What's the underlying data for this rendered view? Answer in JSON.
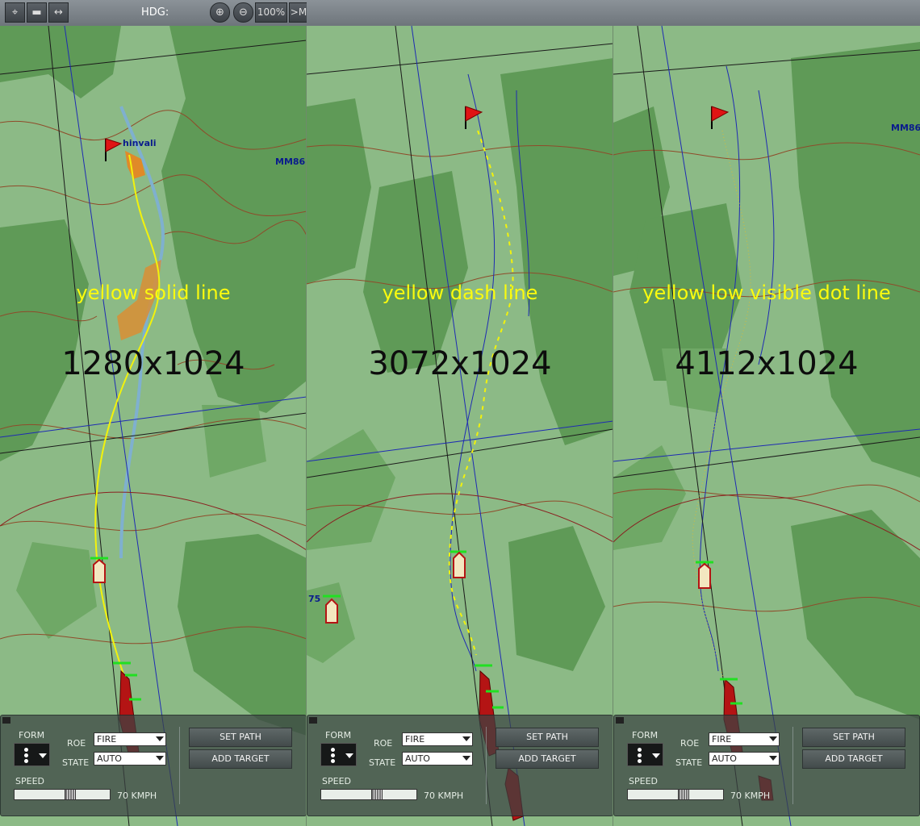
{
  "toolbar": {
    "hdg_label": "HDG:",
    "zoom_value": "100%",
    "more_label": ">M"
  },
  "map": {
    "town_label": "hinvali",
    "grid_label": "MM86",
    "unit_label": "75"
  },
  "panels": [
    {
      "caption": "yellow solid line",
      "resolution": "1280x1024"
    },
    {
      "caption": "yellow dash line",
      "resolution": "3072x1024"
    },
    {
      "caption": "yellow low visible dot line",
      "resolution": "4112x1024"
    }
  ],
  "control": {
    "form_label": "FORM",
    "roe_label": "ROE",
    "roe_value": "FIRE",
    "state_label": "STATE",
    "state_value": "AUTO",
    "speed_label": "SPEED",
    "speed_value": "70 KMPH",
    "set_path_label": "SET PATH",
    "add_target_label": "ADD TARGET"
  },
  "colors": {
    "forest": "#5f9a57",
    "open_ground": "#8cba86",
    "contour": "#8f4b2a",
    "river": "#7fb0cf",
    "path_yellow": "#f2f20c",
    "unit_red": "#c21818"
  },
  "icons": [
    "radar-icon",
    "chat-icon",
    "measure-icon",
    "zoom-in-icon",
    "zoom-out-icon",
    "flag-icon",
    "unit-icon",
    "formation-icon"
  ]
}
